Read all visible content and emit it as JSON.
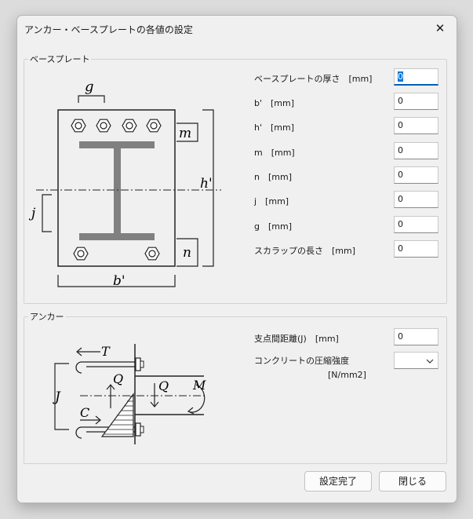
{
  "window": {
    "title": "アンカー・ベースプレートの各値の設定",
    "close_glyph": "✕"
  },
  "baseplate": {
    "group_label": "ベースプレート",
    "fields": [
      {
        "label": "ベースプレートの厚さ　[mm]",
        "value": "0"
      },
      {
        "label": "b'　[mm]",
        "value": "0"
      },
      {
        "label": "h'　[mm]",
        "value": "0"
      },
      {
        "label": "m　[mm]",
        "value": "0"
      },
      {
        "label": "n　[mm]",
        "value": "0"
      },
      {
        "label": "j　[mm]",
        "value": "0"
      },
      {
        "label": "g　[mm]",
        "value": "0"
      },
      {
        "label": "スカラップの長さ　[mm]",
        "value": "0"
      }
    ],
    "diagram_labels": {
      "g": "g",
      "m": "m",
      "h": "h'",
      "j": "j",
      "n": "n",
      "b": "b'"
    }
  },
  "anchor": {
    "group_label": "アンカー",
    "span_label": "支点間距離(J)　[mm]",
    "span_value": "0",
    "strength_label": "コンクリートの圧縮強度",
    "strength_unit": "[N/mm2]",
    "strength_value": "",
    "diagram_labels": {
      "T": "T",
      "Q1": "Q",
      "Q2": "Q",
      "M": "M",
      "J": "J",
      "C": "C"
    }
  },
  "buttons": {
    "ok": "設定完了",
    "close": "閉じる"
  },
  "icons": {
    "dropdown": "chevron-down-icon",
    "close": "close-icon"
  },
  "colors": {
    "accent": "#0078d7",
    "steel": "#808080"
  }
}
